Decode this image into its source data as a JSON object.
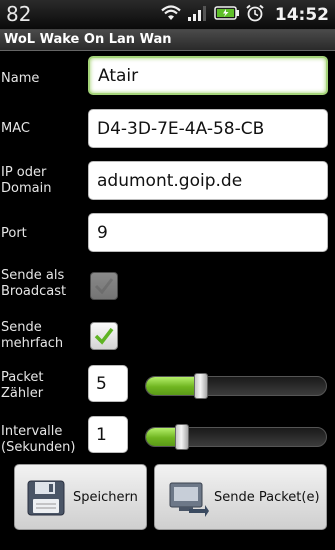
{
  "status_bar": {
    "left_text": "82",
    "time": "14:52",
    "icons": [
      "wifi-icon",
      "signal-icon",
      "battery-icon",
      "alarm-icon"
    ]
  },
  "app": {
    "title": "WoL Wake On Lan Wan"
  },
  "form": {
    "name_label": "Name",
    "name_value": "Atair",
    "mac_label": "MAC",
    "mac_value": "D4-3D-7E-4A-58-CB",
    "host_label_line1": "IP oder",
    "host_label_line2": "Domain",
    "host_value": "adumont.goip.de",
    "port_label": "Port",
    "port_value": "9",
    "broadcast_label_line1": "Sende als",
    "broadcast_label_line2": "Broadcast",
    "broadcast_checked": false,
    "repeat_label_line1": "Sende",
    "repeat_label_line2": "mehrfach",
    "repeat_checked": true,
    "packet_count_label_line1": "Packet",
    "packet_count_label_line2": "Zähler",
    "packet_count_value": "5",
    "packet_count_slider_fraction": 0.25,
    "interval_label_line1": "Intervalle",
    "interval_label_line2": "(Sekunden)",
    "interval_value": "1",
    "interval_slider_fraction": 0.12
  },
  "buttons": {
    "save_label": "Speichern",
    "send_label": "Sende Packet(e)"
  },
  "colors": {
    "accent_green": "#7bc62d",
    "focus_border": "#a5d47a"
  }
}
